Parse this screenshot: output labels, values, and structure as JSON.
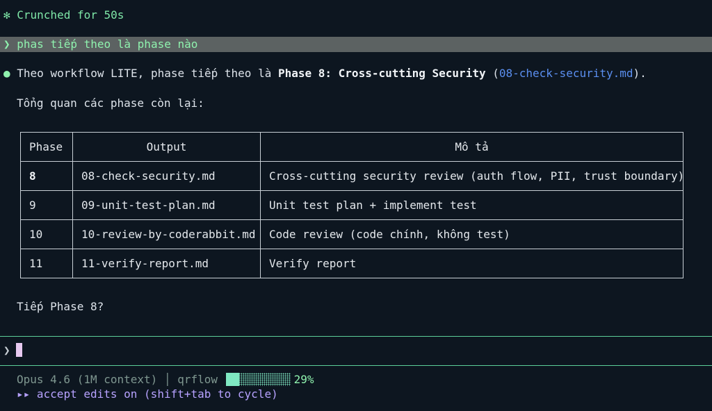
{
  "status": {
    "icon": "asterisk-icon",
    "text": "✻ Crunched for 50s"
  },
  "user_prompt": {
    "caret": "❯",
    "text": "phas tiếp theo là phase nào"
  },
  "answer": {
    "bullet": "●",
    "prefix": "Theo workflow LITE, phase tiếp theo là ",
    "bold": "Phase 8: Cross-cutting Security",
    "open_paren": " (",
    "link": "08-check-security.md",
    "close_paren": ")."
  },
  "overview": "Tổng quan các phase còn lại:",
  "table": {
    "headers": [
      "Phase",
      "Output",
      "Mô tả"
    ],
    "rows": [
      {
        "phase": "8",
        "output": "08-check-security.md",
        "desc": "Cross-cutting security review (auth flow, PII, trust boundary)"
      },
      {
        "phase": "9",
        "output": "09-unit-test-plan.md",
        "desc": "Unit test plan + implement test"
      },
      {
        "phase": "10",
        "output": "10-review-by-coderabbit.md",
        "desc": "Code review (code chính, không test)"
      },
      {
        "phase": "11",
        "output": "11-verify-report.md",
        "desc": "Verify report"
      }
    ]
  },
  "question": "Tiếp Phase 8?",
  "input": {
    "caret": "❯",
    "value": ""
  },
  "footer": {
    "model": "Opus 4.6 (1M context)",
    "separator": "│",
    "project": "qrflow",
    "progress_percent": 29,
    "progress_text": "29%",
    "mode_arrows": "▸▸",
    "mode_text": "accept edits on",
    "mode_hint": "(shift+tab to cycle)"
  },
  "colors": {
    "background": "#0d1620",
    "accent_green": "#8ff2ae",
    "link_blue": "#5b8ff0",
    "mode_purple": "#b7a2ff",
    "prompt_highlight": "#5c6262"
  }
}
